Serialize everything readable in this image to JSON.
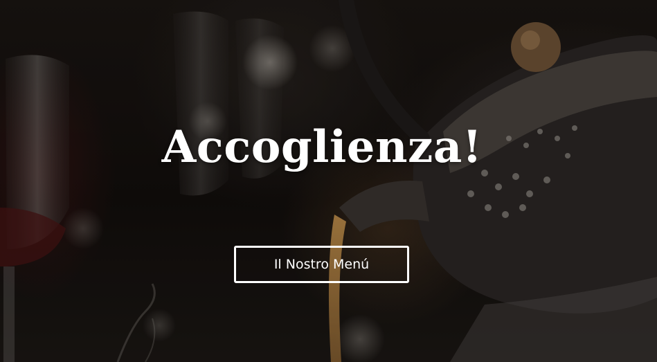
{
  "hero": {
    "heading": "Accoglienza!",
    "button_label": "Il Nostro Menú",
    "background_image": "teapot-pouring-photo",
    "colors": {
      "text": "#ffffff",
      "button_border": "#ffffff",
      "background": "#0d0a08"
    }
  }
}
